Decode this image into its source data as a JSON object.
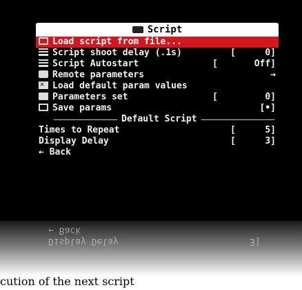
{
  "menu": {
    "title": "Script",
    "items": [
      {
        "icon": "file-icon",
        "label": "Load script from file...",
        "value": "",
        "highlighted": true
      },
      {
        "icon": "list-icon",
        "label": "Script shoot delay (.1s)",
        "value": "0",
        "highlighted": false
      },
      {
        "icon": "list-icon",
        "label": "Script Autostart",
        "value": "Off",
        "highlighted": false
      },
      {
        "icon": "remote-icon",
        "label": "Remote parameters",
        "value": "→",
        "highlighted": false
      },
      {
        "icon": "close-icon",
        "label": "Load default param values",
        "value": "",
        "highlighted": false
      },
      {
        "icon": "parameter-icon",
        "label": "Parameters set",
        "value": "0",
        "highlighted": false
      },
      {
        "icon": "save-icon",
        "label": "Save params",
        "value": "[•]",
        "highlighted": false
      }
    ],
    "section_label": "Default Script",
    "section_items": [
      {
        "label": "Times to Repeat",
        "value": "5"
      },
      {
        "label": "Display Delay",
        "value": "3"
      }
    ],
    "back_label": "← Back"
  },
  "reflection": {
    "line1": "← Back",
    "line2": "Display Delay",
    "line2_value": "3]"
  },
  "caption": "cution of the next script"
}
